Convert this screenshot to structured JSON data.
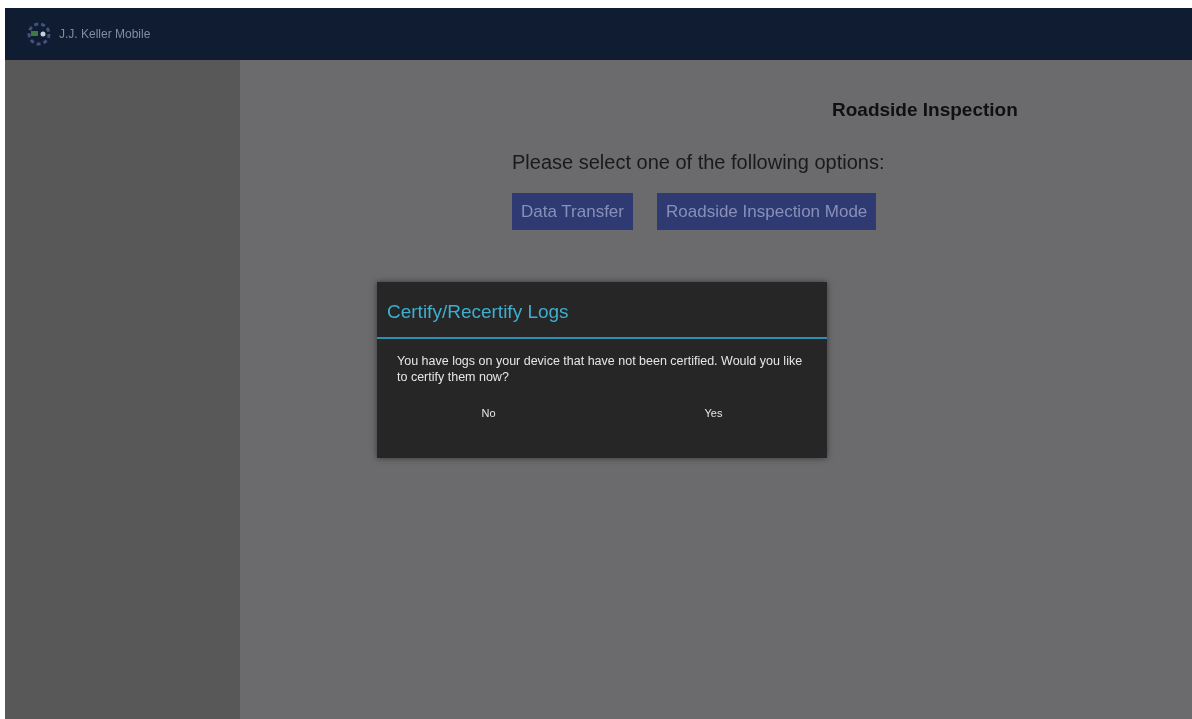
{
  "app_bar": {
    "title": "J.J. Keller Mobile"
  },
  "page": {
    "title": "Roadside Inspection",
    "prompt": "Please select one of the following options:",
    "buttons": [
      "Data Transfer",
      "Roadside Inspection Mode"
    ]
  },
  "dialog": {
    "title": "Certify/Recertify Logs",
    "message": "You have logs on your device that have not been certified. Would you like to certify them now?",
    "buttons": [
      "No",
      "Yes"
    ]
  }
}
